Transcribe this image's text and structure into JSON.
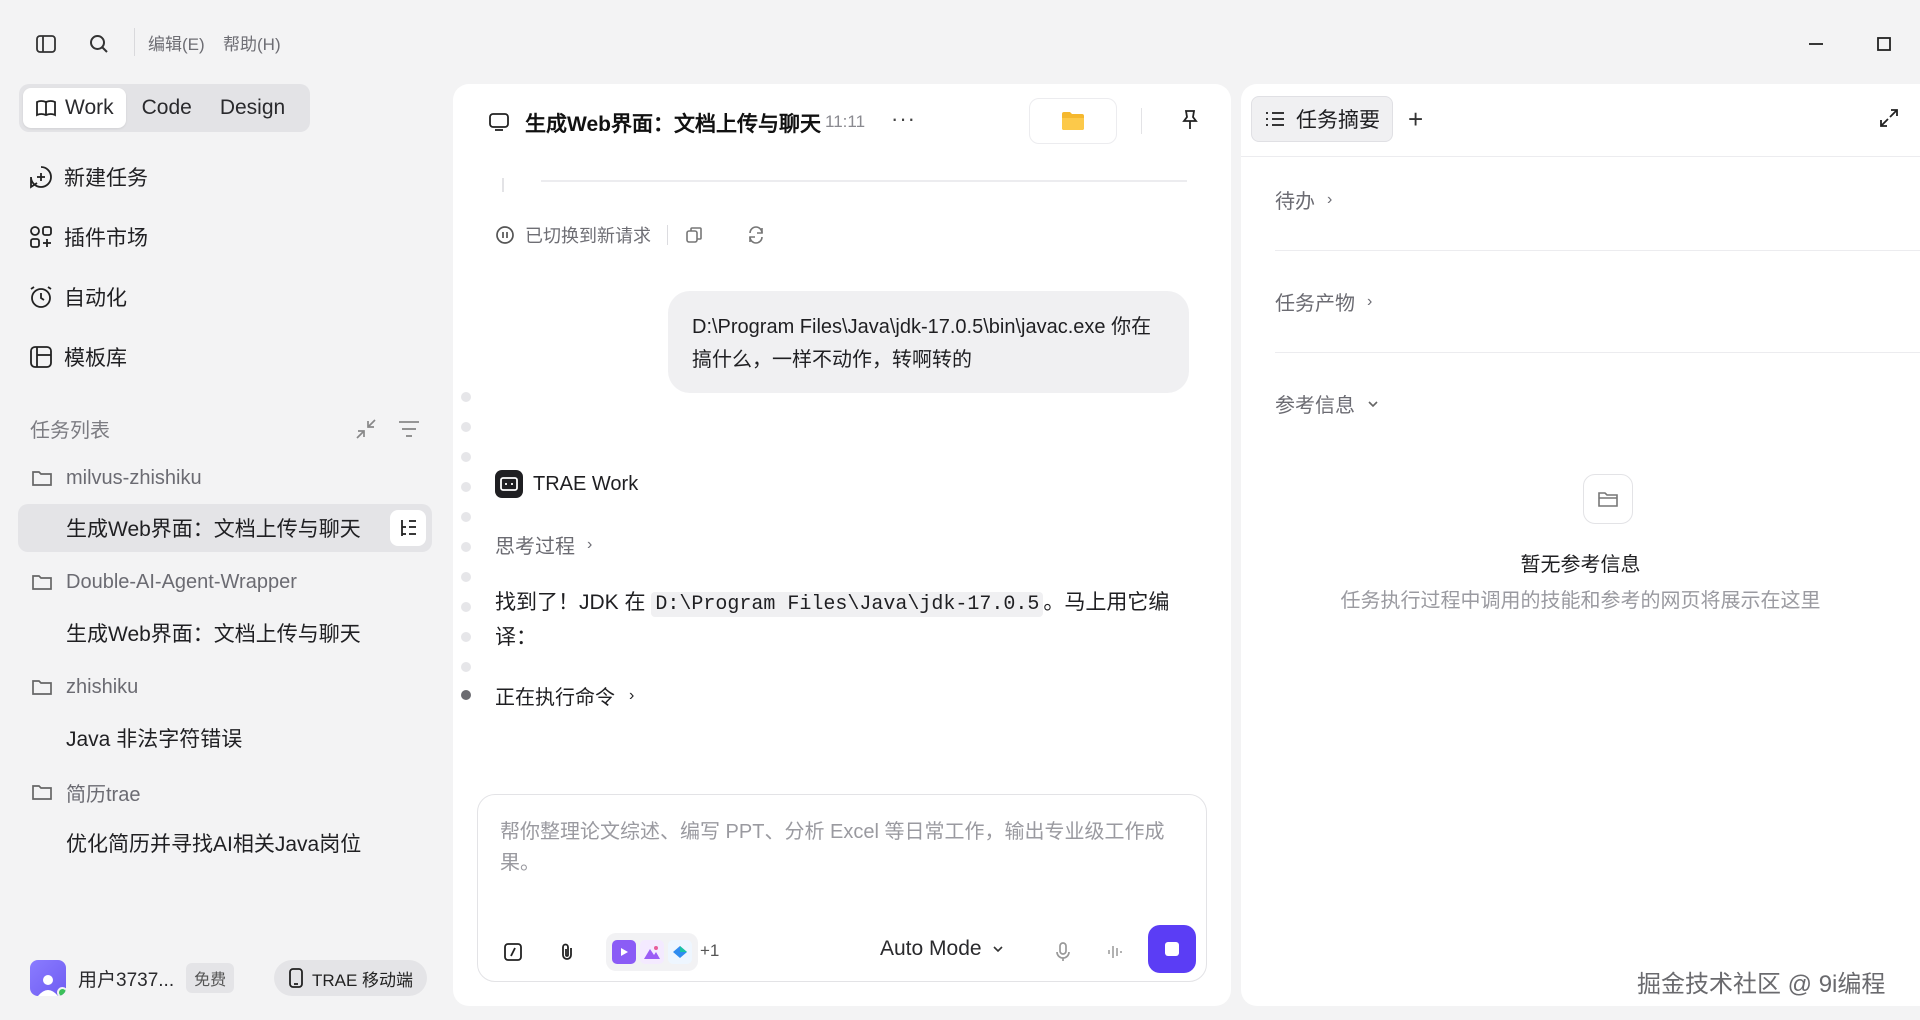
{
  "menu": {
    "edit": "编辑(E)",
    "help": "帮助(H)"
  },
  "modes": {
    "work": "Work",
    "code": "Code",
    "design": "Design"
  },
  "nav": {
    "new_task": "新建任务",
    "plugins": "插件市场",
    "automation": "自动化",
    "templates": "模板库"
  },
  "task_list": {
    "header": "任务列表",
    "groups": [
      {
        "folder": "milvus-zhishiku",
        "tasks": [
          "生成Web界面：文档上传与聊天"
        ]
      },
      {
        "folder": "Double-AI-Agent-Wrapper",
        "tasks": [
          "生成Web界面：文档上传与聊天"
        ]
      },
      {
        "folder": "zhishiku",
        "tasks": [
          "Java 非法字符错误"
        ]
      },
      {
        "folder": "简历trae",
        "tasks": [
          "优化简历并寻找AI相关Java岗位"
        ]
      }
    ]
  },
  "user": {
    "name": "用户3737...",
    "plan": "免费",
    "mobile": "TRAE 移动端"
  },
  "chat": {
    "title": "生成Web界面：文档上传与聊天",
    "time": "11:11",
    "more": "···",
    "switched": "已切换到新请求",
    "user_message_line1": "D:\\Program Files\\Java\\jdk-17.0.5\\bin\\javac.exe 你在",
    "user_message_line2": "搞什么，一样不动作，转啊转的",
    "agent_name": "TRAE Work",
    "thinking": "思考过程",
    "answer_prefix": "找到了！JDK 在 ",
    "answer_code": "D:\\Program Files\\Java\\jdk-17.0.5",
    "answer_suffix": "。马上用它编",
    "answer_line2": "译：",
    "running": "正在执行命令"
  },
  "composer": {
    "placeholder_line1": "帮你整理论文综述、编写 PPT、分析 Excel 等日常工作，输出专业级工作成",
    "placeholder_line2": "果。",
    "more_skills": "+1",
    "mode": "Auto Mode"
  },
  "summary": {
    "tab": "任务摘要",
    "add": "+",
    "todo": "待办",
    "artifacts": "任务产物",
    "references": "参考信息",
    "empty_title": "暂无参考信息",
    "empty_sub": "任务执行过程中调用的技能和参考的网页将展示在这里"
  },
  "watermark": "掘金技术社区 @ 9i编程",
  "colors": {
    "accent": "#5b3df5",
    "folder": "#f5b82e"
  }
}
